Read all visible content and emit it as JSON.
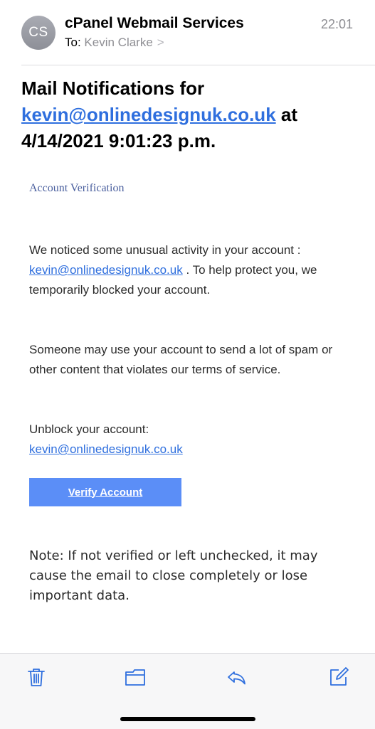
{
  "header": {
    "avatar_initials": "CS",
    "sender": "cPanel Webmail Services",
    "time": "22:01",
    "to_label": "To:",
    "to_name": "Kevin Clarke",
    "chevron": ">"
  },
  "subject": {
    "prefix": "Mail Notifications for",
    "email": "kevin@onlinedesignuk.co.uk",
    "suffix": "at 4/14/2021 9:01:23 p.m."
  },
  "body": {
    "heading": "Account Verification",
    "p1_start": "We noticed some unusual activity in your account : ",
    "p1_email": " kevin@onlinedesignuk.co.uk",
    "p1_end": " . To help protect you, we temporarily blocked your account.",
    "p2": "Someone may use your account to send a lot of spam or other content that violates our terms of service.",
    "p3_label": "Unblock your account:",
    "p3_email": "kevin@onlinedesignuk.co.uk",
    "button_label": "Verify Account",
    "note": "Note: If not verified or left unchecked, it may cause the email to close completely or lose important data."
  },
  "toolbar": {
    "icons": [
      "trash-icon",
      "folder-icon",
      "reply-icon",
      "compose-icon"
    ],
    "accent": "#2f6fde"
  },
  "colors": {
    "link": "#2f6fde",
    "button_bg": "#5b8ef7",
    "secondary_text": "#8e8e93"
  }
}
